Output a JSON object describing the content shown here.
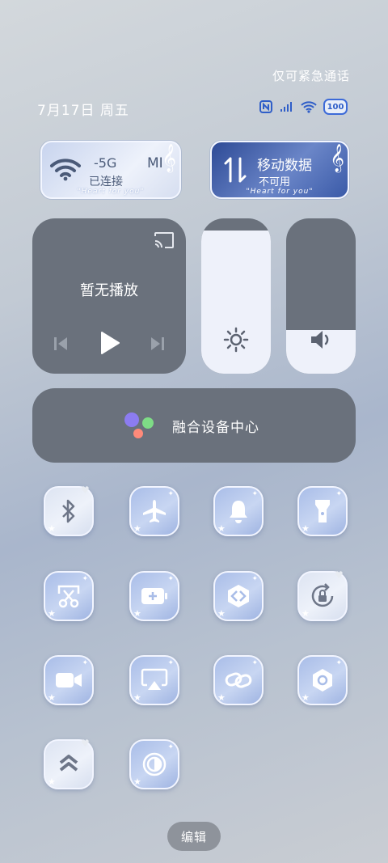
{
  "status": {
    "emergency_text": "仅可紧急通话",
    "date": "7月17日 周五",
    "battery_level": "100"
  },
  "wifi_card": {
    "name": "-5G",
    "brand": "MI",
    "status": "已连接",
    "tagline": "\"Heart for you\""
  },
  "data_card": {
    "title": "移动数据",
    "status": "不可用",
    "tagline": "\"Heart for you\""
  },
  "media": {
    "title": "暂无播放"
  },
  "sliders": {
    "brightness_level": 0.92,
    "volume_level": 0.28
  },
  "assistant": {
    "label": "融合设备中心"
  },
  "toggles": [
    {
      "name": "bluetooth",
      "icon": "bluetooth-icon",
      "active": false
    },
    {
      "name": "airplane-mode",
      "icon": "airplane-icon",
      "active": true
    },
    {
      "name": "sound",
      "icon": "bell-icon",
      "active": true
    },
    {
      "name": "flashlight",
      "icon": "flashlight-icon",
      "active": true
    },
    {
      "name": "screenshot",
      "icon": "scissors-icon",
      "active": true
    },
    {
      "name": "battery-saver",
      "icon": "battery-plus-icon",
      "active": true
    },
    {
      "name": "vpn",
      "icon": "vpn-icon",
      "active": true
    },
    {
      "name": "auto-rotate",
      "icon": "rotation-lock-icon",
      "active": false
    },
    {
      "name": "screen-record",
      "icon": "video-icon",
      "active": true
    },
    {
      "name": "screen-cast",
      "icon": "cast-icon",
      "active": true
    },
    {
      "name": "link-share",
      "icon": "link-icon",
      "active": true
    },
    {
      "name": "settings",
      "icon": "hexagon-gear-icon",
      "active": true
    },
    {
      "name": "performance",
      "icon": "chevrons-up-icon",
      "active": false
    },
    {
      "name": "dark-mode",
      "icon": "contrast-icon",
      "active": true
    }
  ],
  "footer": {
    "edit_label": "编辑"
  }
}
